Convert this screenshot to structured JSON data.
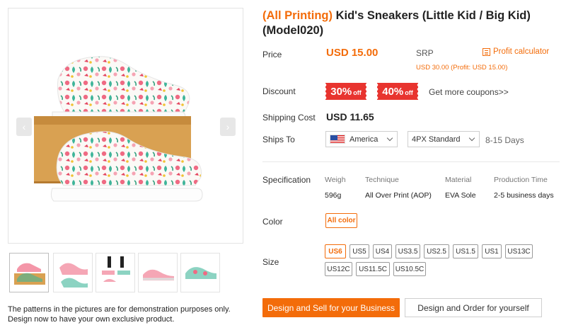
{
  "product": {
    "title_tag": "(All Printing)",
    "title_text": " Kid's Sneakers (Little Kid / Big Kid) (Model020)"
  },
  "price": {
    "label": "Price",
    "value": "USD 15.00",
    "srp_label": "SRP",
    "srp_value": "USD 30.00 (Profit: USD 15.00)",
    "profit_calculator": "Profit calculator"
  },
  "discount": {
    "label": "Discount",
    "coupons": [
      {
        "percent": "30%",
        "suffix": "off"
      },
      {
        "percent": "40%",
        "suffix": "off"
      }
    ],
    "more": "Get more coupons>>"
  },
  "shipping": {
    "label": "Shipping Cost",
    "value": "USD 11.65"
  },
  "ships_to": {
    "label": "Ships To",
    "country": "America",
    "method": "4PX Standard",
    "days": "8-15 Days"
  },
  "specification": {
    "label": "Specification",
    "headers": [
      "Weigh",
      "Technique",
      "Material",
      "Production Time"
    ],
    "values": [
      "596g",
      "All Over Print (AOP)",
      "EVA Sole",
      "2-5 business days"
    ]
  },
  "color": {
    "label": "Color",
    "selected": "All color"
  },
  "size": {
    "label": "Size",
    "options": [
      "US6",
      "US5",
      "US4",
      "US3.5",
      "US2.5",
      "US1.5",
      "US1",
      "US13C",
      "US12C",
      "US11.5C",
      "US10.5C"
    ],
    "selected": "US6"
  },
  "actions": {
    "design_sell": "Design and Sell for your Business",
    "design_order": "Design and Order for yourself"
  },
  "gallery": {
    "arrow_left": "‹",
    "arrow_right": "›",
    "note_line1": "The patterns in the pictures are for demonstration purposes only.",
    "note_line2": "Design now to have your own exclusive product."
  },
  "colors": {
    "accent": "#f36c0a",
    "coupon": "#e8342f"
  }
}
